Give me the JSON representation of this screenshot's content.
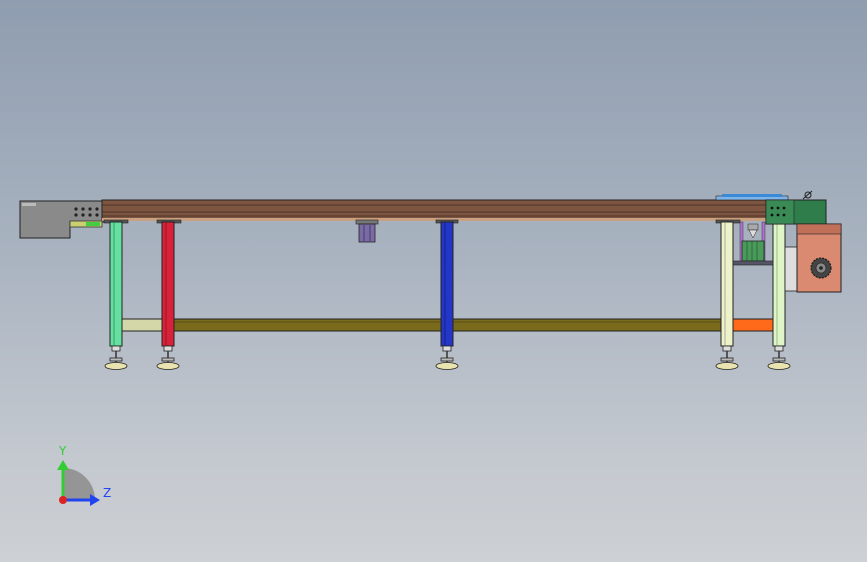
{
  "viewport": {
    "view_orientation": "front",
    "model_type": "conveyor assembly"
  },
  "triad": {
    "y_label": "Y",
    "z_label": "Z",
    "y_color": "#33cc33",
    "z_color": "#2244ee",
    "x_color": "#dd2222"
  },
  "colors": {
    "frame_top": "#7d5540",
    "left_housing": "#8c8c8c",
    "right_housing": "#2f7d4a",
    "motor": "#d98a70",
    "leg_green": "#66e0a0",
    "leg_red": "#d8223a",
    "leg_blue": "#2436c8",
    "leg_light": "#e8ecc0",
    "crossbar": "#7a6a1c",
    "crossbar_left": "#d4d8a8",
    "crossbar_right": "#ff6a1a",
    "foot": "#e9e3b0"
  }
}
